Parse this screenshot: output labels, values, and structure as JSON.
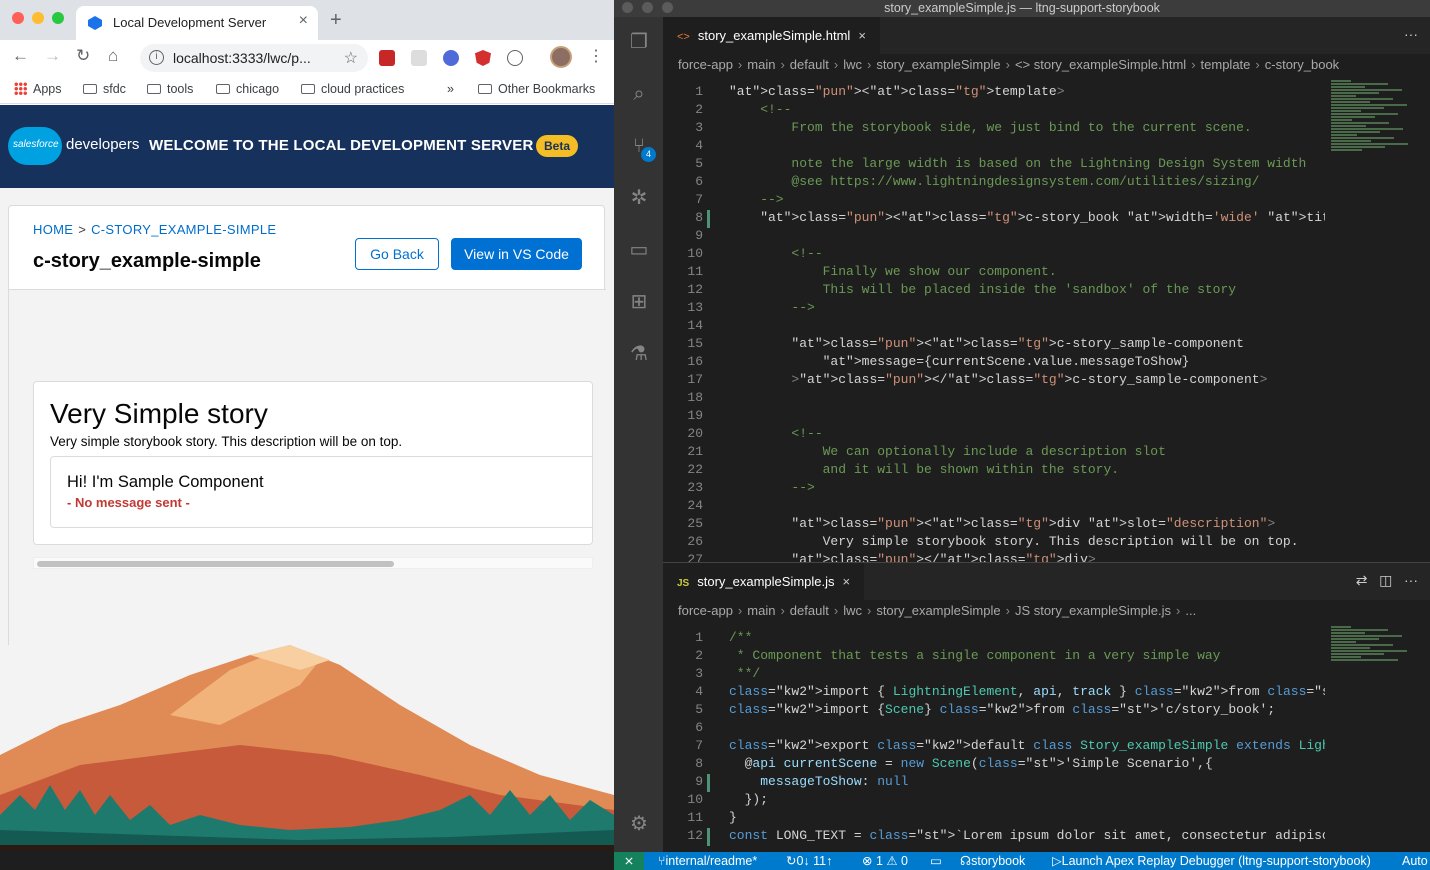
{
  "browser": {
    "tab_title": "Local Development Server",
    "url": "localhost:3333/lwc/p...",
    "bookmarks": [
      "Apps",
      "sfdc",
      "tools",
      "chicago",
      "cloud practices"
    ],
    "bookmarks_more": "»",
    "other_bookmarks": "Other Bookmarks"
  },
  "page": {
    "logo_text": "salesforce",
    "developers": "developers",
    "welcome": "WELCOME TO THE LOCAL DEVELOPMENT SERVER",
    "beta": "Beta",
    "breadcrumb_home": "HOME",
    "breadcrumb_sep": ">",
    "breadcrumb_current": "C-STORY_EXAMPLE-SIMPLE",
    "component_title": "c-story_example-simple",
    "go_back": "Go Back",
    "view_vscode": "View in VS Code",
    "story_title": "Very Simple story",
    "story_description": "Very simple storybook story. This description will be on top.",
    "sample_heading": "Hi! I'm Sample Component",
    "sample_message": "- No message sent -"
  },
  "vscode": {
    "window_title": "story_exampleSimple.js — ltng-support-storybook",
    "top_tab": "story_exampleSimple.html",
    "top_tab_icon": "<>",
    "top_breadcrumb": [
      "force-app",
      "main",
      "default",
      "lwc",
      "story_exampleSimple",
      "<> story_exampleSimple.html",
      "template",
      "c-story_book"
    ],
    "bottom_tab": "story_exampleSimple.js",
    "bottom_tab_icon": "JS",
    "bottom_breadcrumb": [
      "force-app",
      "main",
      "default",
      "lwc",
      "story_exampleSimple",
      "JS story_exampleSimple.js",
      "..."
    ],
    "status": {
      "branch": "internal/readme*",
      "sync": "0↓ 11↑",
      "problems": "⊗ 1 ⚠ 0",
      "project": "storybook",
      "launch": "Launch Apex Replay Debugger (ltng-support-storybook)",
      "auto": "Auto"
    }
  },
  "html_code": [
    "<template>",
    "    <!--",
    "        From the storybook side, we just bind to the current scene.",
    "",
    "        note the large width is based on the Lightning Design System width",
    "        @see https://www.lightningdesignsystem.com/utilities/sizing/",
    "    -->",
    "    <c-story_book width='wide' title='Very Simple story'>",
    "",
    "        <!--",
    "            Finally we show our component.",
    "            This will be placed inside the 'sandbox' of the story",
    "        -->",
    "",
    "        <c-story_sample-component",
    "            message={currentScene.value.messageToShow}",
    "        ></c-story_sample-component>",
    "",
    "",
    "        <!--",
    "            We can optionally include a description slot",
    "            and it will be shown within the story.",
    "        -->",
    "",
    "        <div slot=\"description\">",
    "            Very simple storybook story. This description will be on top.",
    "        </div>"
  ],
  "js_code": [
    "/**",
    " * Component that tests a single component in a very simple way",
    " **/",
    "import { LightningElement, api, track } from 'lwc'; // eslint-disable-line no-unuse",
    "import {Scene} from 'c/story_book';",
    "",
    "export default class Story_exampleSimple extends LightningElement {",
    "  @api currentScene = new Scene('Simple Scenario',{",
    "    messageToShow: null",
    "  });",
    "}",
    "const LONG_TEXT = `Lorem ipsum dolor sit amet, consectetur adipiscing elit, sed do"
  ],
  "colors": {
    "sf_navy": "#16325c",
    "sf_blue": "#0070d2",
    "vscode_blue": "#007acc",
    "error_red": "#c23934"
  }
}
